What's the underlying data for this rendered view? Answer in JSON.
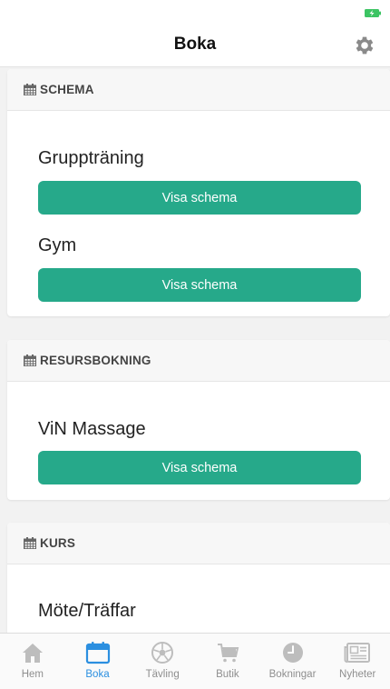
{
  "header": {
    "title": "Boka"
  },
  "sections": [
    {
      "title": "SCHEMA",
      "items": [
        {
          "title": "Gruppträning",
          "button": "Visa schema"
        },
        {
          "title": "Gym",
          "button": "Visa schema"
        }
      ]
    },
    {
      "title": "RESURSBOKNING",
      "items": [
        {
          "title": "ViN Massage",
          "button": "Visa schema"
        }
      ]
    },
    {
      "title": "KURS",
      "items": [
        {
          "title": "Möte/Träffar"
        }
      ]
    }
  ],
  "tabs": [
    {
      "label": "Hem",
      "icon": "home-icon",
      "active": false
    },
    {
      "label": "Boka",
      "icon": "calendar-icon",
      "active": true
    },
    {
      "label": "Tävling",
      "icon": "soccer-ball-icon",
      "active": false
    },
    {
      "label": "Butik",
      "icon": "cart-icon",
      "active": false
    },
    {
      "label": "Bokningar",
      "icon": "clock-icon",
      "active": false
    },
    {
      "label": "Nyheter",
      "icon": "newspaper-icon",
      "active": false
    }
  ],
  "colors": {
    "accent": "#26a98a",
    "tab_active": "#2b8fe0",
    "tab_inactive": "#9a9a9a",
    "battery": "#3cc463"
  }
}
